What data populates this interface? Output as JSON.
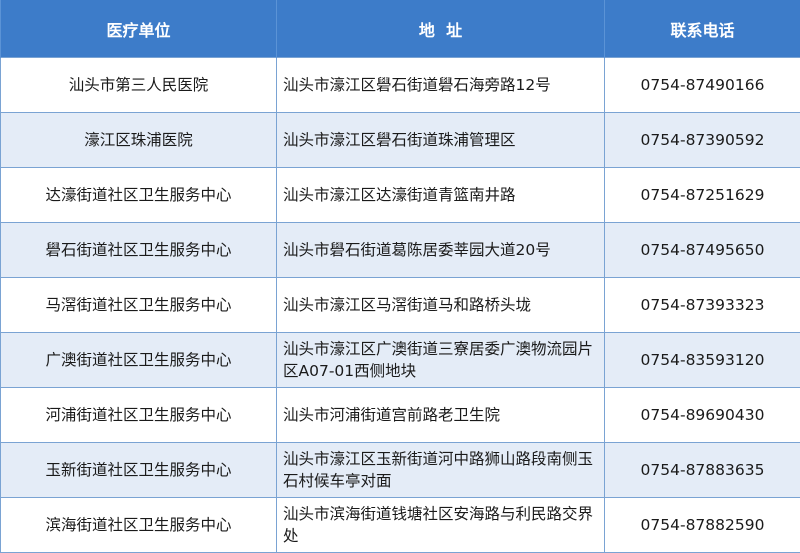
{
  "header": {
    "unit": "医疗单位",
    "address": "地  址",
    "phone": "联系电话"
  },
  "rows": [
    {
      "unit": "汕头市第三人民医院",
      "address": "汕头市濠江区礐石街道礐石海旁路12号",
      "phone": "0754-87490166"
    },
    {
      "unit": "濠江区珠浦医院",
      "address": "汕头市濠江区礐石街道珠浦管理区",
      "phone": "0754-87390592"
    },
    {
      "unit": "达濠街道社区卫生服务中心",
      "address": "汕头市濠江区达濠街道青篮南井路",
      "phone": "0754-87251629"
    },
    {
      "unit": "礐石街道社区卫生服务中心",
      "address": "汕头市礐石街道葛陈居委莘园大道20号",
      "phone": "0754-87495650"
    },
    {
      "unit": "马滘街道社区卫生服务中心",
      "address": "汕头市濠江区马滘街道马和路桥头垅",
      "phone": "0754-87393323"
    },
    {
      "unit": "广澳街道社区卫生服务中心",
      "address": "汕头市濠江区广澳街道三寮居委广澳物流园片区A07-01西侧地块",
      "phone": "0754-83593120"
    },
    {
      "unit": "河浦街道社区卫生服务中心",
      "address": "汕头市河浦街道宫前路老卫生院",
      "phone": "0754-89690430"
    },
    {
      "unit": "玉新街道社区卫生服务中心",
      "address": "汕头市濠江区玉新街道河中路狮山路段南侧玉石村候车亭对面",
      "phone": "0754-87883635"
    },
    {
      "unit": "滨海街道社区卫生服务中心",
      "address": "汕头市滨海街道钱塘社区安海路与利民路交界处",
      "phone": "0754-87882590"
    }
  ]
}
